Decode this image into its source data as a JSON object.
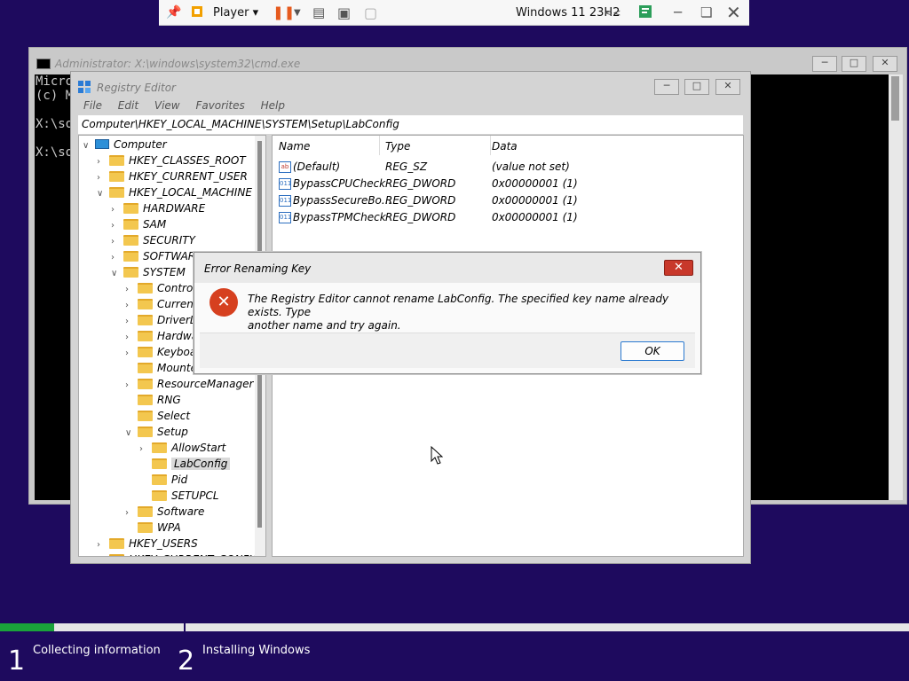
{
  "vm_toolbar": {
    "player_label": "Player",
    "vm_name": "Windows 11 23H2",
    "collapse_glyph": "<<"
  },
  "cmd": {
    "title": "Administrator: X:\\windows\\system32\\cmd.exe",
    "lines": [
      "Micro",
      "(c) M",
      "",
      "X:\\so",
      "",
      "X:\\so"
    ]
  },
  "regedit": {
    "title": "Registry Editor",
    "menu": [
      "File",
      "Edit",
      "View",
      "Favorites",
      "Help"
    ],
    "address": "Computer\\HKEY_LOCAL_MACHINE\\SYSTEM\\Setup\\LabConfig",
    "tree": [
      {
        "label": "Computer",
        "chev": "v",
        "level": 0,
        "icon": "computer-icon"
      },
      {
        "label": "HKEY_CLASSES_ROOT",
        "chev": ">",
        "level": 1
      },
      {
        "label": "HKEY_CURRENT_USER",
        "chev": ">",
        "level": 1
      },
      {
        "label": "HKEY_LOCAL_MACHINE",
        "chev": "v",
        "level": 1
      },
      {
        "label": "HARDWARE",
        "chev": ">",
        "level": 2
      },
      {
        "label": "SAM",
        "chev": ">",
        "level": 2
      },
      {
        "label": "SECURITY",
        "chev": ">",
        "level": 2
      },
      {
        "label": "SOFTWARE",
        "chev": ">",
        "level": 2
      },
      {
        "label": "SYSTEM",
        "chev": "v",
        "level": 2
      },
      {
        "label": "ControlS",
        "chev": ">",
        "level": 3
      },
      {
        "label": "Current",
        "chev": ">",
        "level": 3
      },
      {
        "label": "DriverD",
        "chev": ">",
        "level": 3
      },
      {
        "label": "Hardwa",
        "chev": ">",
        "level": 3
      },
      {
        "label": "Keyboar",
        "chev": ">",
        "level": 3
      },
      {
        "label": "Mounte",
        "chev": "",
        "level": 3
      },
      {
        "label": "ResourceManager",
        "chev": ">",
        "level": 3
      },
      {
        "label": "RNG",
        "chev": "",
        "level": 3
      },
      {
        "label": "Select",
        "chev": "",
        "level": 3
      },
      {
        "label": "Setup",
        "chev": "v",
        "level": 3
      },
      {
        "label": "AllowStart",
        "chev": ">",
        "level": 4
      },
      {
        "label": "LabConfig",
        "chev": "",
        "level": 4,
        "selected": true
      },
      {
        "label": "Pid",
        "chev": "",
        "level": 4
      },
      {
        "label": "SETUPCL",
        "chev": "",
        "level": 4
      },
      {
        "label": "Software",
        "chev": ">",
        "level": 3
      },
      {
        "label": "WPA",
        "chev": "",
        "level": 3
      },
      {
        "label": "HKEY_USERS",
        "chev": ">",
        "level": 1
      },
      {
        "label": "HKEY_CURRENT_CONFIG",
        "chev": ">",
        "level": 1
      }
    ],
    "columns": [
      "Name",
      "Type",
      "Data"
    ],
    "values": [
      {
        "icon": "string-value-icon",
        "icon_text": "ab",
        "name": "(Default)",
        "type": "REG_SZ",
        "data": "(value not set)"
      },
      {
        "icon": "binary-value-icon",
        "icon_text": "011",
        "name": "BypassCPUCheck",
        "type": "REG_DWORD",
        "data": "0x00000001 (1)"
      },
      {
        "icon": "binary-value-icon",
        "icon_text": "011",
        "name": "BypassSecureBo...",
        "type": "REG_DWORD",
        "data": "0x00000001 (1)"
      },
      {
        "icon": "binary-value-icon",
        "icon_text": "011",
        "name": "BypassTPMCheck",
        "type": "REG_DWORD",
        "data": "0x00000001 (1)"
      }
    ]
  },
  "dialog": {
    "title": "Error Renaming Key",
    "message_line1": "The Registry Editor cannot rename LabConfig. The specified key name already exists. Type",
    "message_line2": "another name and try again.",
    "ok_label": "OK"
  },
  "setup_status": {
    "progress": 0.06,
    "steps": [
      {
        "number": "1",
        "label": "Collecting information"
      },
      {
        "number": "2",
        "label": "Installing Windows"
      }
    ]
  },
  "colors": {
    "background": "#1e0a5e",
    "progress_fill": "#1aa33a",
    "error_red": "#d6401f",
    "selection": "#d9d9d9"
  }
}
